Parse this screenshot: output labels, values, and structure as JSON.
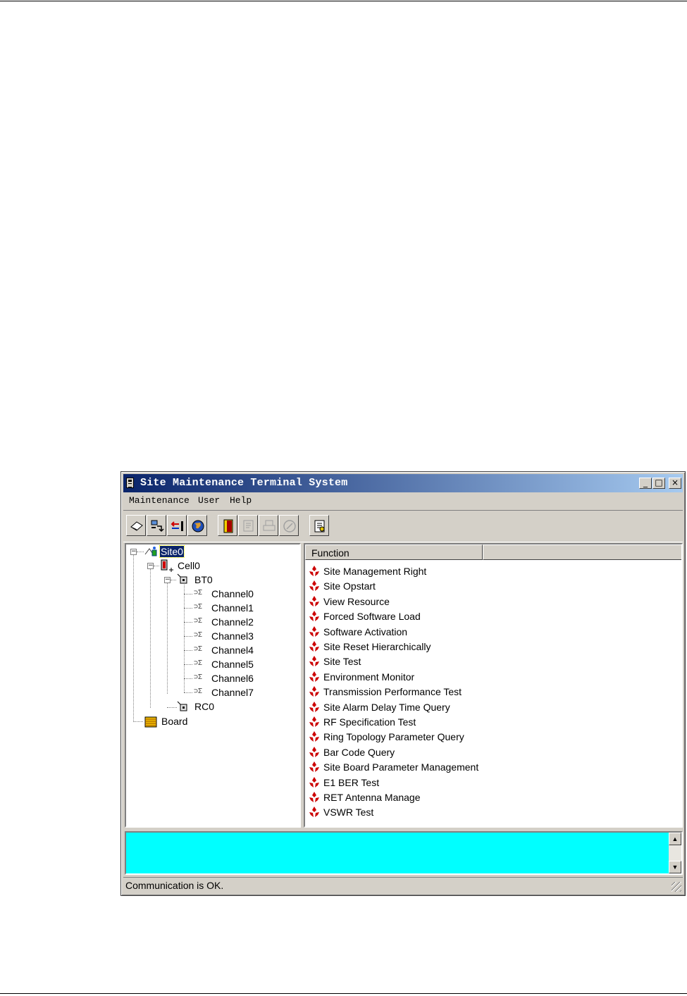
{
  "window": {
    "title": "Site Maintenance Terminal System",
    "buttons": [
      "_",
      "□",
      "×"
    ]
  },
  "menu": [
    {
      "label": "Maintenance"
    },
    {
      "label": "User"
    },
    {
      "label": "Help"
    }
  ],
  "toolbar": {
    "icons": [
      "open-icon",
      "connect-icon",
      "disconnect-icon",
      "globe-icon",
      "exit-icon",
      "config-icon",
      "print-icon",
      "stop-icon",
      "report-icon"
    ]
  },
  "tree": {
    "site": "Site0",
    "cell": "Cell0",
    "bt": "BT0",
    "channels": [
      "Channel0",
      "Channel1",
      "Channel2",
      "Channel3",
      "Channel4",
      "Channel5",
      "Channel6",
      "Channel7"
    ],
    "rc": "RC0",
    "board": "Board"
  },
  "functions": {
    "column": "Function",
    "items": [
      "Site Management Right",
      "Site Opstart",
      "View Resource",
      "Forced Software Load",
      "Software Activation",
      "Site Reset Hierarchically",
      "Site Test",
      "Environment Monitor",
      "Transmission Performance Test",
      "Site Alarm Delay Time Query",
      "RF Specification Test",
      "Ring Topology Parameter Query",
      "Bar Code Query",
      "Site Board Parameter Management",
      "E1 BER Test",
      "RET Antenna Manage",
      "VSWR Test"
    ]
  },
  "status": {
    "text": "Communication is OK."
  },
  "colors": {
    "title_start": "#0a246a",
    "title_end": "#a6caf0",
    "console": "#00ffff",
    "function_icon": "#cc0000"
  }
}
